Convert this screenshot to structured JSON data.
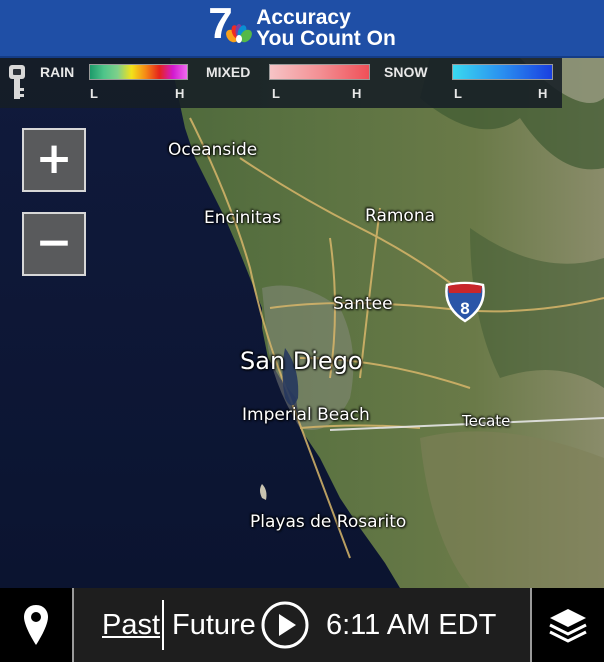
{
  "header": {
    "logo_number": "7",
    "tagline_line1": "Accuracy",
    "tagline_line2": "You Count On",
    "brand_color": "#1f4fa6"
  },
  "legend": {
    "key_icon": "key-icon",
    "rain": {
      "label": "RAIN",
      "low": "L",
      "high": "H"
    },
    "mixed": {
      "label": "MIXED",
      "low": "L",
      "high": "H"
    },
    "snow": {
      "label": "SNOW",
      "low": "L",
      "high": "H"
    }
  },
  "map": {
    "places": {
      "oceanside": "Oceanside",
      "encinitas": "Encinitas",
      "ramona": "Ramona",
      "santee": "Santee",
      "san_diego": "San Diego",
      "imperial_beach": "Imperial Beach",
      "tecate": "Tecate",
      "playas": "Playas de Rosarito"
    },
    "interstate_shield": "8",
    "water_color": "#0f1a3a"
  },
  "controls": {
    "zoom_in": "+",
    "zoom_out": "−"
  },
  "bottombar": {
    "location_icon": "location-pin-icon",
    "past_label": "Past",
    "future_label": "Future",
    "play_icon": "play-icon",
    "time": "6:11 AM EDT",
    "layers_icon": "layers-icon"
  }
}
